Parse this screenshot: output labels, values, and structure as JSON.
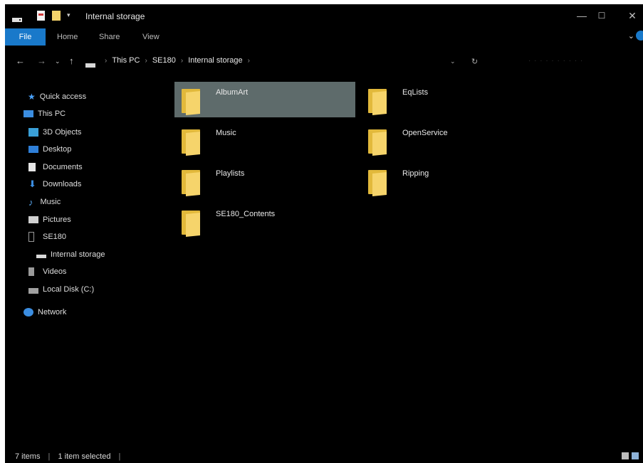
{
  "window": {
    "title": "Internal storage",
    "caption": {
      "minimize": "—",
      "maximize": "☐",
      "close": "✕"
    }
  },
  "ribbon": {
    "tabs": [
      "File",
      "Home",
      "Share",
      "View"
    ]
  },
  "address": {
    "crumbs": [
      "This PC",
      "SE180",
      "Internal storage"
    ]
  },
  "sidebar": {
    "quick_access": "Quick access",
    "this_pc": "This PC",
    "items": [
      {
        "label": "3D Objects",
        "icon": "3d-objects-icon"
      },
      {
        "label": "Desktop",
        "icon": "desktop-icon"
      },
      {
        "label": "Documents",
        "icon": "documents-icon"
      },
      {
        "label": "Downloads",
        "icon": "downloads-icon"
      },
      {
        "label": "Music",
        "icon": "music-icon"
      },
      {
        "label": "Pictures",
        "icon": "pictures-icon"
      },
      {
        "label": "SE180",
        "icon": "device-icon"
      },
      {
        "label": "Internal storage",
        "icon": "drive-icon"
      },
      {
        "label": "Videos",
        "icon": "videos-icon"
      },
      {
        "label": "Local Disk (C:)",
        "icon": "local-disk-icon"
      }
    ],
    "network": "Network"
  },
  "folders": [
    {
      "name": "AlbumArt",
      "selected": true
    },
    {
      "name": "EqLists",
      "selected": false
    },
    {
      "name": "Music",
      "selected": false
    },
    {
      "name": "OpenService",
      "selected": false
    },
    {
      "name": "Playlists",
      "selected": false
    },
    {
      "name": "Ripping",
      "selected": false
    },
    {
      "name": "SE180_Contents",
      "selected": false
    }
  ],
  "status": {
    "items": "7 items",
    "selected": "1 item selected"
  },
  "colors": {
    "accent": "#1979ca",
    "background": "#000000",
    "selection": "#5e6b6b",
    "folder": "#f6d46b"
  }
}
